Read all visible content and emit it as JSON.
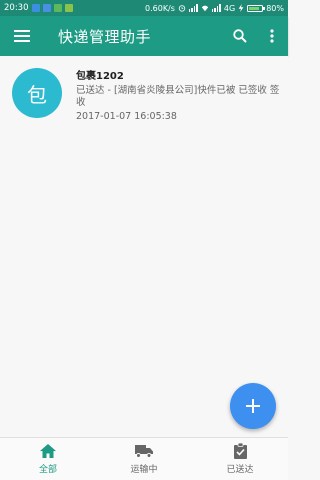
{
  "status_bar": {
    "time": "20:30",
    "network_speed": "0.60K/s",
    "network_type": "4G",
    "battery_percent": "80%",
    "battery_level": 0.8
  },
  "toolbar": {
    "title": "快递管理助手",
    "menu_icon": "menu-icon",
    "search_icon": "search-icon",
    "more_icon": "more-vert-icon"
  },
  "packages": [
    {
      "avatar_char": "包",
      "name": "包裹1202",
      "status": "已送达 - [湖南省炎陵县公司]快件已被 已签收 签收",
      "time": "2017-01-07 16:05:38"
    }
  ],
  "fab": {
    "icon": "add-icon",
    "label": "+"
  },
  "bottom_nav": {
    "items": [
      {
        "label": "全部",
        "icon": "home-icon",
        "active": true
      },
      {
        "label": "运输中",
        "icon": "truck-icon",
        "active": false
      },
      {
        "label": "已送达",
        "icon": "clipboard-check-icon",
        "active": false
      }
    ]
  },
  "colors": {
    "primary": "#1e9b84",
    "status_bar": "#1e8a76",
    "avatar": "#2cbad0",
    "fab": "#3d8ff0"
  }
}
